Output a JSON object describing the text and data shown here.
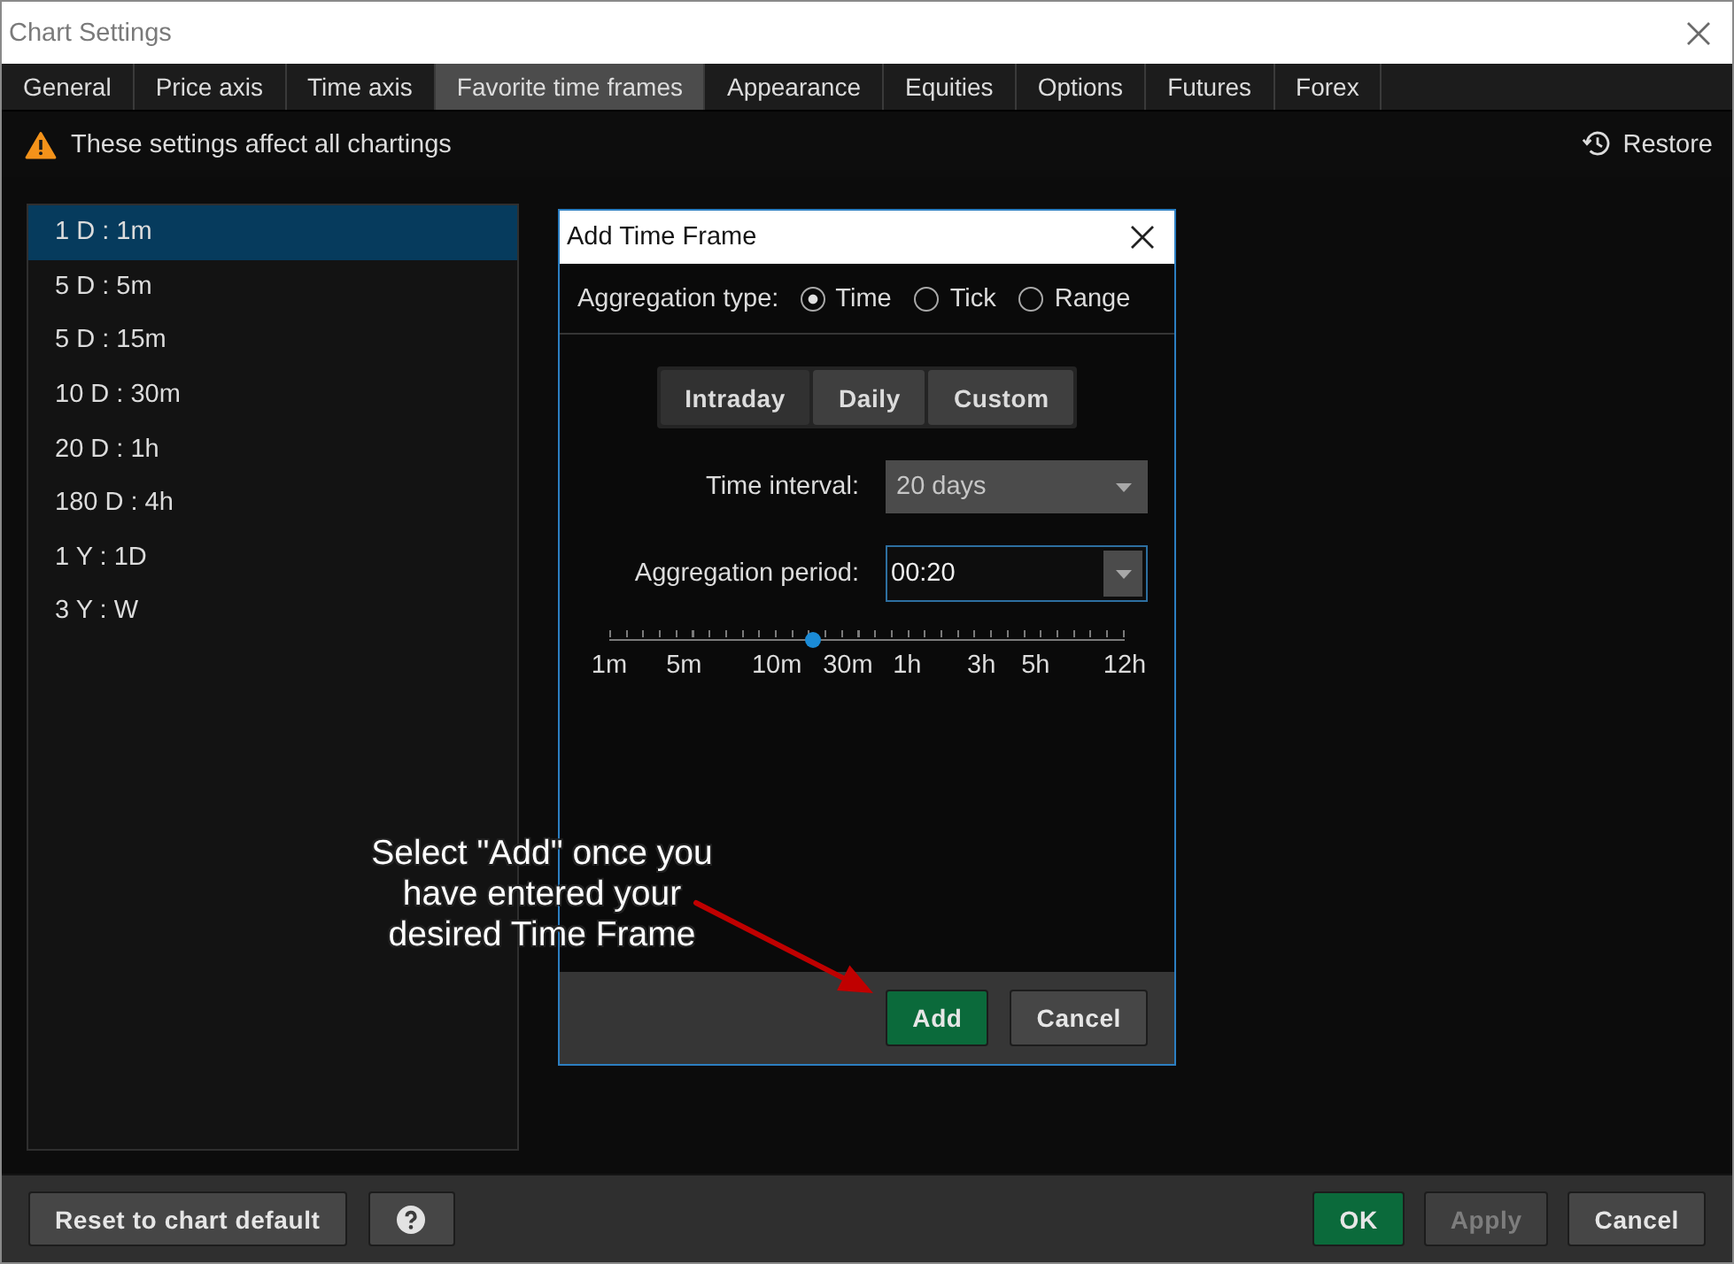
{
  "window": {
    "title": "Chart Settings"
  },
  "tabs": [
    {
      "label": "General",
      "selected": false
    },
    {
      "label": "Price axis",
      "selected": false
    },
    {
      "label": "Time axis",
      "selected": false
    },
    {
      "label": "Favorite time frames",
      "selected": true
    },
    {
      "label": "Appearance",
      "selected": false
    },
    {
      "label": "Equities",
      "selected": false
    },
    {
      "label": "Options",
      "selected": false
    },
    {
      "label": "Futures",
      "selected": false
    },
    {
      "label": "Forex",
      "selected": false
    }
  ],
  "notice": {
    "text": "These settings affect all chartings",
    "restore_label": "Restore"
  },
  "time_frames": [
    {
      "label": "1 D : 1m",
      "selected": true
    },
    {
      "label": "5 D : 5m",
      "selected": false
    },
    {
      "label": "5 D : 15m",
      "selected": false
    },
    {
      "label": "10 D : 30m",
      "selected": false
    },
    {
      "label": "20 D : 1h",
      "selected": false
    },
    {
      "label": "180 D : 4h",
      "selected": false
    },
    {
      "label": "1 Y : 1D",
      "selected": false
    },
    {
      "label": "3 Y : W",
      "selected": false
    }
  ],
  "dialog": {
    "title": "Add Time Frame",
    "aggregation_label": "Aggregation type:",
    "aggregation_types": [
      {
        "label": "Time",
        "selected": true
      },
      {
        "label": "Tick",
        "selected": false
      },
      {
        "label": "Range",
        "selected": false
      }
    ],
    "modes": [
      {
        "label": "Intraday",
        "selected": true
      },
      {
        "label": "Daily",
        "selected": false
      },
      {
        "label": "Custom",
        "selected": false
      }
    ],
    "time_interval": {
      "label": "Time interval:",
      "value": "20 days"
    },
    "aggregation_period": {
      "label": "Aggregation period:",
      "value": "00:20"
    },
    "period_slider": {
      "level": 0.396,
      "tick_labels": [
        "1m",
        "5m",
        "10m",
        "30m",
        "1h",
        "3h",
        "5h",
        "12h"
      ]
    },
    "buttons": [
      {
        "label": "Add",
        "kind": "primary"
      },
      {
        "label": "Cancel",
        "kind": "secondary"
      }
    ]
  },
  "annotation": {
    "lines": [
      "Select \"Add\" once you",
      "have entered your",
      "desired Time Frame"
    ]
  },
  "footer": {
    "left_buttons": [
      {
        "label": "Reset to chart default",
        "kind": "secondary",
        "disabled": false
      },
      {
        "kind": "help",
        "disabled": false
      }
    ],
    "right_buttons": [
      {
        "label": "OK",
        "kind": "primary",
        "disabled": false
      },
      {
        "label": "Apply",
        "kind": "secondary",
        "disabled": true
      },
      {
        "label": "Cancel",
        "kind": "secondary",
        "disabled": false
      }
    ]
  }
}
